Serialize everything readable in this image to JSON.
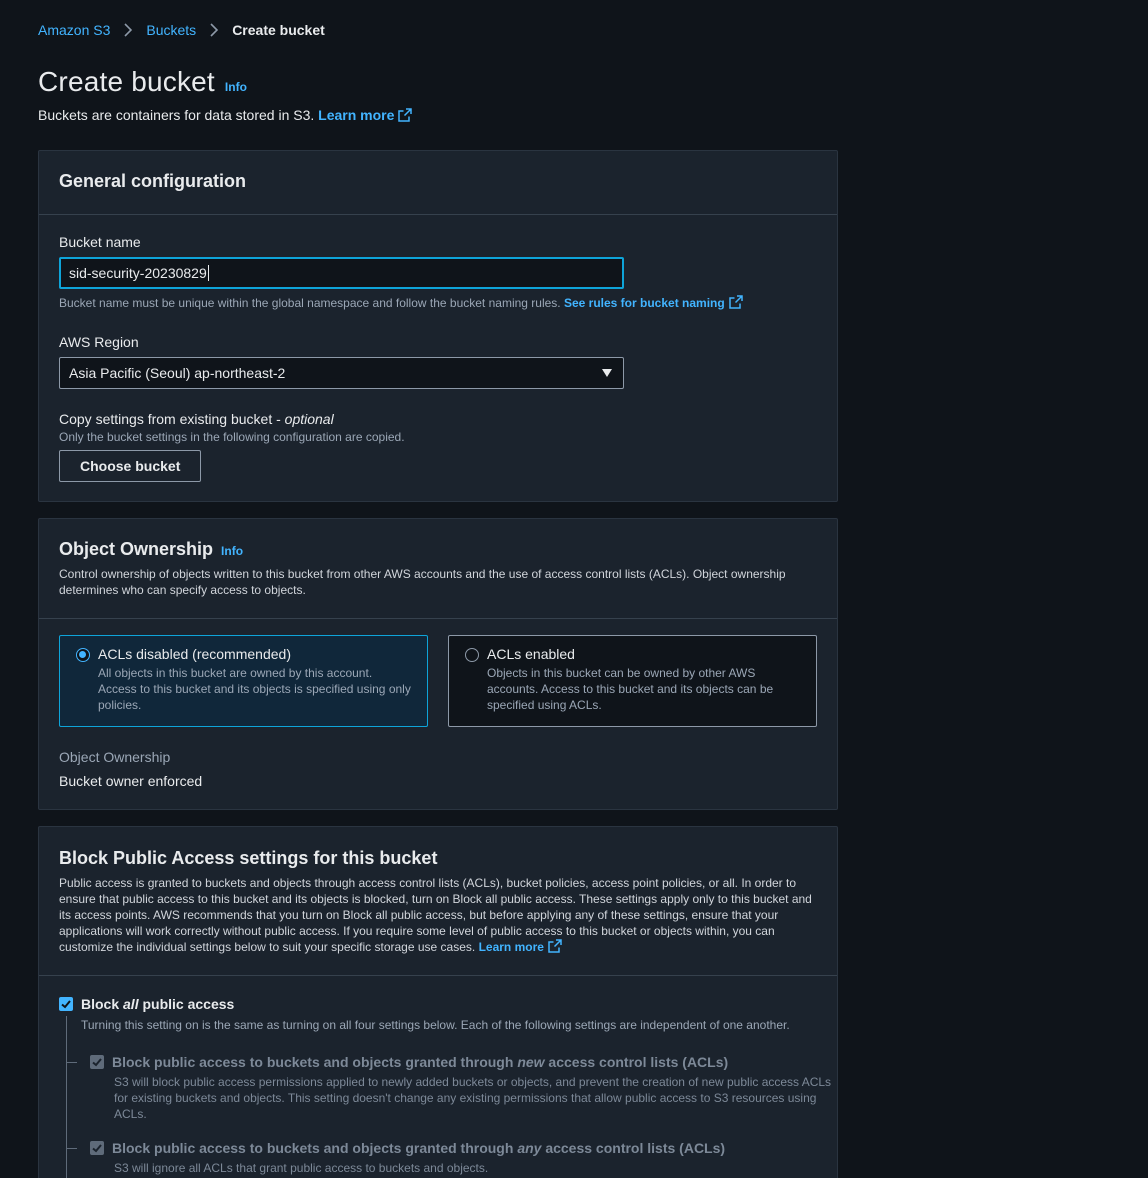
{
  "breadcrumb": {
    "items": [
      "Amazon S3",
      "Buckets"
    ],
    "current": "Create bucket"
  },
  "header": {
    "title": "Create bucket",
    "info": "Info",
    "description": "Buckets are containers for data stored in S3.",
    "learn_more": "Learn more"
  },
  "general": {
    "title": "General configuration",
    "bucket_name_label": "Bucket name",
    "bucket_name_value": "sid-security-20230829",
    "bucket_name_hint": "Bucket name must be unique within the global namespace and follow the bucket naming rules.",
    "bucket_name_rules_link": "See rules for bucket naming",
    "region_label": "AWS Region",
    "region_value": "Asia Pacific (Seoul) ap-northeast-2",
    "copy_label": "Copy settings from existing bucket - ",
    "copy_optional": "optional",
    "copy_hint": "Only the bucket settings in the following configuration are copied.",
    "choose_button": "Choose bucket"
  },
  "ownership": {
    "title": "Object Ownership",
    "info": "Info",
    "description": "Control ownership of objects written to this bucket from other AWS accounts and the use of access control lists (ACLs). Object ownership determines who can specify access to objects.",
    "options": [
      {
        "title": "ACLs disabled (recommended)",
        "desc": "All objects in this bucket are owned by this account. Access to this bucket and its objects is specified using only policies.",
        "selected": true
      },
      {
        "title": "ACLs enabled",
        "desc": "Objects in this bucket can be owned by other AWS accounts. Access to this bucket and its objects can be specified using ACLs.",
        "selected": false
      }
    ],
    "result_key": "Object Ownership",
    "result_value": "Bucket owner enforced"
  },
  "block_public": {
    "title": "Block Public Access settings for this bucket",
    "description": "Public access is granted to buckets and objects through access control lists (ACLs), bucket policies, access point policies, or all. In order to ensure that public access to this bucket and its objects is blocked, turn on Block all public access. These settings apply only to this bucket and its access points. AWS recommends that you turn on Block all public access, but before applying any of these settings, ensure that your applications will work correctly without public access. If you require some level of public access to this bucket or objects within, you can customize the individual settings below to suit your specific storage use cases.",
    "learn_more": "Learn more",
    "all_label_pre": "Block ",
    "all_label_em": "all",
    "all_label_post": " public access",
    "all_desc": "Turning this setting on is the same as turning on all four settings below. Each of the following settings are independent of one another.",
    "items": [
      {
        "pre": "Block public access to buckets and objects granted through ",
        "em": "new",
        "post": " access control lists (ACLs)",
        "desc": "S3 will block public access permissions applied to newly added buckets or objects, and prevent the creation of new public access ACLs for existing buckets and objects. This setting doesn't change any existing permissions that allow public access to S3 resources using ACLs."
      },
      {
        "pre": "Block public access to buckets and objects granted through ",
        "em": "any",
        "post": " access control lists (ACLs)",
        "desc": "S3 will ignore all ACLs that grant public access to buckets and objects."
      }
    ]
  },
  "colors": {
    "accent": "#42b4ff",
    "focus_border": "#0ea4d9",
    "background": "#0f141a",
    "panel": "#1b232d"
  }
}
